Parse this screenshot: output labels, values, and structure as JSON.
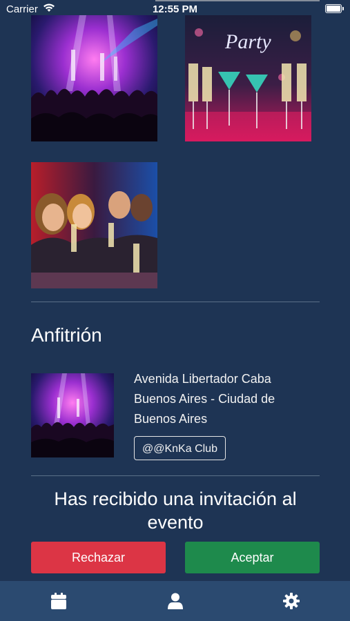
{
  "status": {
    "carrier": "Carrier",
    "time": "12:55 PM"
  },
  "gallery": {
    "photos": [
      {
        "alt": "concert-crowd-photo"
      },
      {
        "alt": "party-cocktails-photo"
      },
      {
        "alt": "friends-toasting-photo"
      }
    ]
  },
  "host": {
    "title": "Anfitrión",
    "address": "Avenida Libertador Caba Buenos Aires - Ciudad de Buenos Aires",
    "tag": "@@KnKa Club"
  },
  "invitation": {
    "message": "Has recibido una invitación al evento",
    "reject_label": "Rechazar",
    "accept_label": "Aceptar"
  },
  "colors": {
    "background": "#1e3454",
    "tabbar": "#2b4a70",
    "reject": "#dc3545",
    "accept": "#1e8a4c"
  },
  "tabbar": {
    "items": [
      {
        "icon": "calendar-icon"
      },
      {
        "icon": "user-icon"
      },
      {
        "icon": "gear-icon"
      }
    ]
  }
}
